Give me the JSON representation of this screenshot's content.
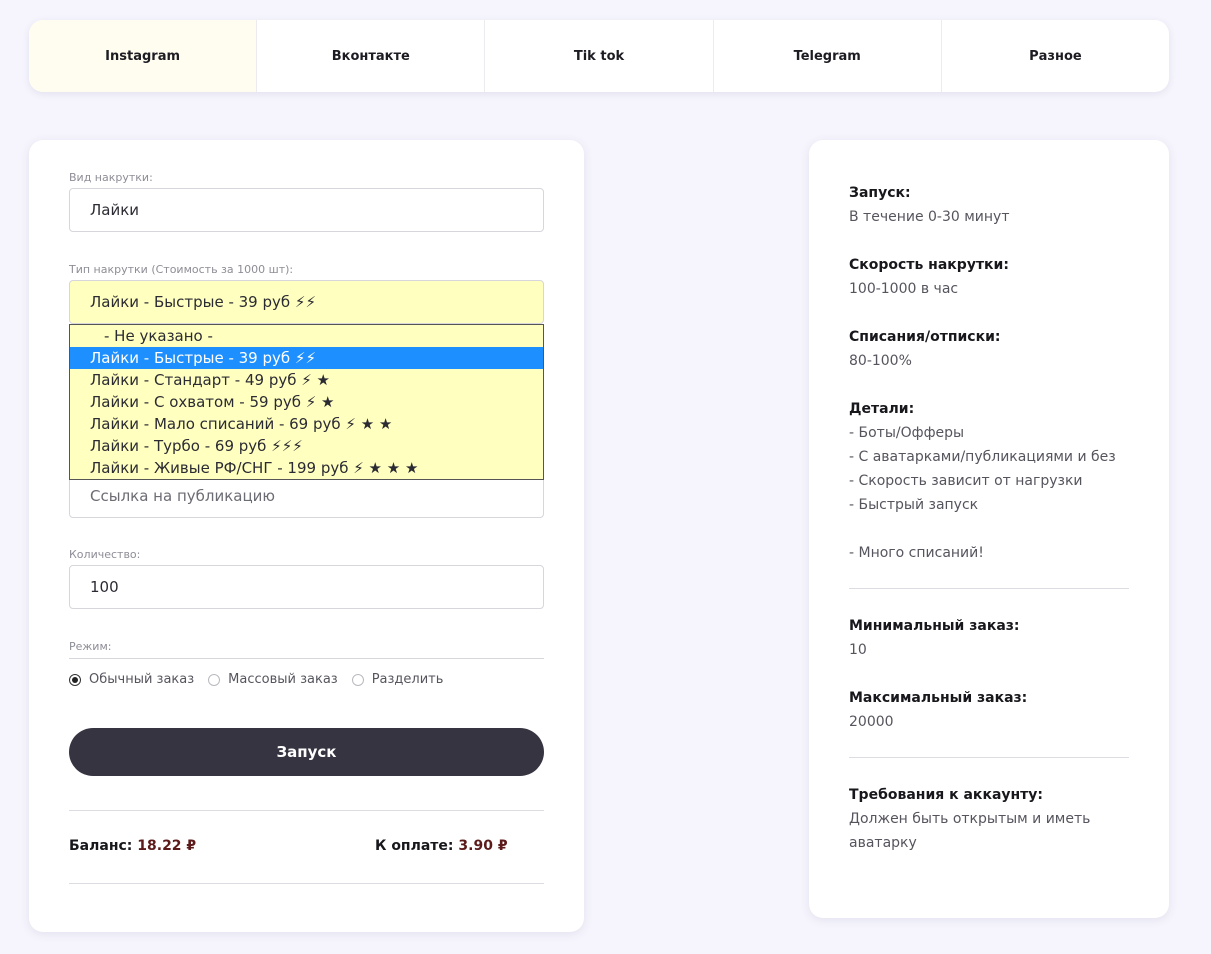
{
  "tabs": [
    "Instagram",
    "Вконтакте",
    "Tik tok",
    "Telegram",
    "Разное"
  ],
  "form": {
    "kind_label": "Вид накрутки:",
    "kind_value": "Лайки",
    "type_label": "Тип накрутки (Стоимость за 1000 шт):",
    "type_value": "Лайки - Быстрые - 39 руб ⚡⚡",
    "options": [
      "- Не указано -",
      "Лайки - Быстрые - 39 руб ⚡⚡",
      "Лайки - Стандарт - 49 руб ⚡ ★",
      "Лайки - С охватом - 59 руб ⚡ ★",
      "Лайки - Мало списаний - 69 руб ⚡ ★ ★",
      "Лайки - Турбо - 69 руб ⚡⚡⚡",
      "Лайки - Живые РФ/СНГ - 199 руб ⚡ ★ ★ ★"
    ],
    "selected_option": 1,
    "link_placeholder": "Ссылка на публикацию",
    "qty_label": "Количество:",
    "qty_value": "100",
    "mode_label": "Режим:",
    "modes": [
      "Обычный заказ",
      "Массовый заказ",
      "Разделить"
    ],
    "mode_selected": 0,
    "launch_label": "Запуск",
    "balance_label": "Баланс:",
    "balance_value": "18.22 ₽",
    "pay_label": "К оплате:",
    "pay_value": "3.90 ₽"
  },
  "info": {
    "start_h": "Запуск:",
    "start_t": "В течение 0-30 минут",
    "speed_h": "Скорость накрутки:",
    "speed_t": "100-1000 в час",
    "drop_h": "Списания/отписки:",
    "drop_t": "80-100%",
    "details_h": "Детали:",
    "details": [
      "- Боты/Офферы",
      "- С аватарками/публикациями и без",
      "- Скорость зависит от нагрузки",
      "- Быстрый запуск",
      "",
      "- Много списаний!"
    ],
    "min_h": "Минимальный заказ:",
    "min_t": "10",
    "max_h": "Максимальный заказ:",
    "max_t": "20000",
    "req_h": "Требования к аккаунту:",
    "req_t": "Должен быть открытым и иметь аватарку"
  },
  "colors": {
    "select_bg": "#ffffc0",
    "selected_opt": "#1e8fff",
    "button": "#363441",
    "page_bg": "#f6f5fd"
  }
}
